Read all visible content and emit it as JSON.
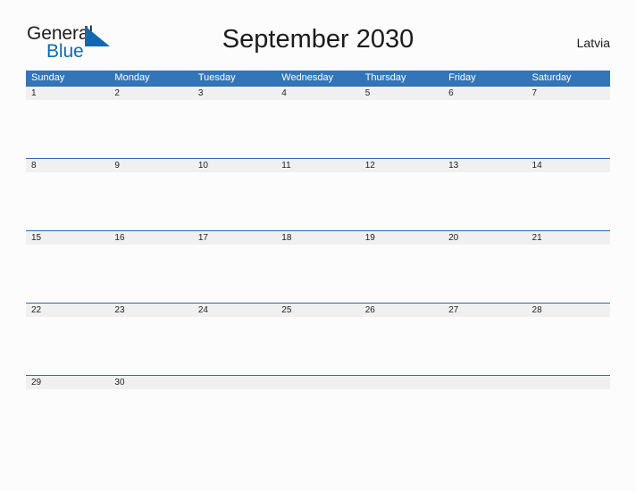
{
  "branding": {
    "name_part1": "General",
    "name_part2": "Blue",
    "flag_icon": "blue-triangle-flag-icon",
    "brand_blue": "#1268b3"
  },
  "header": {
    "title": "September 2030",
    "region": "Latvia"
  },
  "colors": {
    "header_blue": "#3275b8",
    "row_divider_blue": "#2e6da4",
    "daynum_band": "#f0f0f0",
    "page_background": "#fcfcfd",
    "text": "#1b1b1b"
  },
  "calendar": {
    "month": "September",
    "year": "2030",
    "weekdays": [
      "Sunday",
      "Monday",
      "Tuesday",
      "Wednesday",
      "Thursday",
      "Friday",
      "Saturday"
    ],
    "weeks": [
      [
        "1",
        "2",
        "3",
        "4",
        "5",
        "6",
        "7"
      ],
      [
        "8",
        "9",
        "10",
        "11",
        "12",
        "13",
        "14"
      ],
      [
        "15",
        "16",
        "17",
        "18",
        "19",
        "20",
        "21"
      ],
      [
        "22",
        "23",
        "24",
        "25",
        "26",
        "27",
        "28"
      ],
      [
        "29",
        "30",
        "",
        "",
        "",
        "",
        ""
      ]
    ]
  }
}
